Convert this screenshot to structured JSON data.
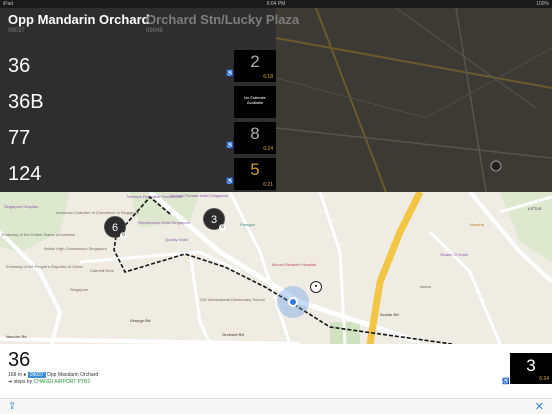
{
  "status_bar": {
    "carrier": "iPad",
    "time": "6:04 PM",
    "battery": "100%"
  },
  "stops": [
    {
      "name": "Opp Mandarin Orchard",
      "code": "09037"
    },
    {
      "name": "Orchard Stn/Lucky Plaza",
      "code": "09048"
    }
  ],
  "services": [
    {
      "number": "36",
      "arrival": "2",
      "time": "6:18",
      "wheelchair": "♿"
    },
    {
      "number": "36B",
      "arrival": "",
      "note": "No Estimate Available",
      "time": "",
      "wheelchair": ""
    },
    {
      "number": "77",
      "arrival": "8",
      "time": "6:24",
      "wheelchair": "♿"
    },
    {
      "number": "124",
      "arrival": "5",
      "time": "6:21",
      "wheelchair": "♿"
    }
  ],
  "map": {
    "clusters": [
      {
        "count": "6",
        "badge": "6"
      },
      {
        "count": "3",
        "badge": "6"
      }
    ],
    "labels": {
      "singapore": "Singapore",
      "hospital": "Singapore Hospital",
      "chamber": "American Chamber of Commerce in Singapore",
      "treelodge": "Treetops Executive Residences",
      "orchard_parade": "Orchard Parade Hotel Singapore",
      "rendezvous": "Rendezvous Hotel Singapore",
      "fortress": "Quality Hotel",
      "us_embassy": "Embassy of the United States of America",
      "british": "British High Commission Singapore",
      "china": "Embassy of the People's Republic of China",
      "cairnhill": "Cairnhill Nine",
      "elizabeth": "Mount Elizabeth Hospital",
      "sig": "SIG International Elementary School",
      "paragon": "Paragon",
      "orchard_rd": "Orchard Rd",
      "nassim": "Nassim Rd",
      "grange": "Grange Rd",
      "scotts": "Scotts Rd",
      "sloane": "Sloane Ct Hotel",
      "novena": "Novena",
      "little": "LITTLE",
      "istana": "Istana"
    }
  },
  "card": {
    "service": "36",
    "distance": "168 m",
    "stop_code": "09037",
    "stop_name": "Opp Mandarin Orchard",
    "stops_prefix": "stops by",
    "destination": "CHANGI AIRPORT PTB2",
    "arrival": "3",
    "time": "6:24",
    "wheelchair": "♿"
  },
  "toolbar": {
    "share_icon": "⇪",
    "close_icon": "✕"
  }
}
